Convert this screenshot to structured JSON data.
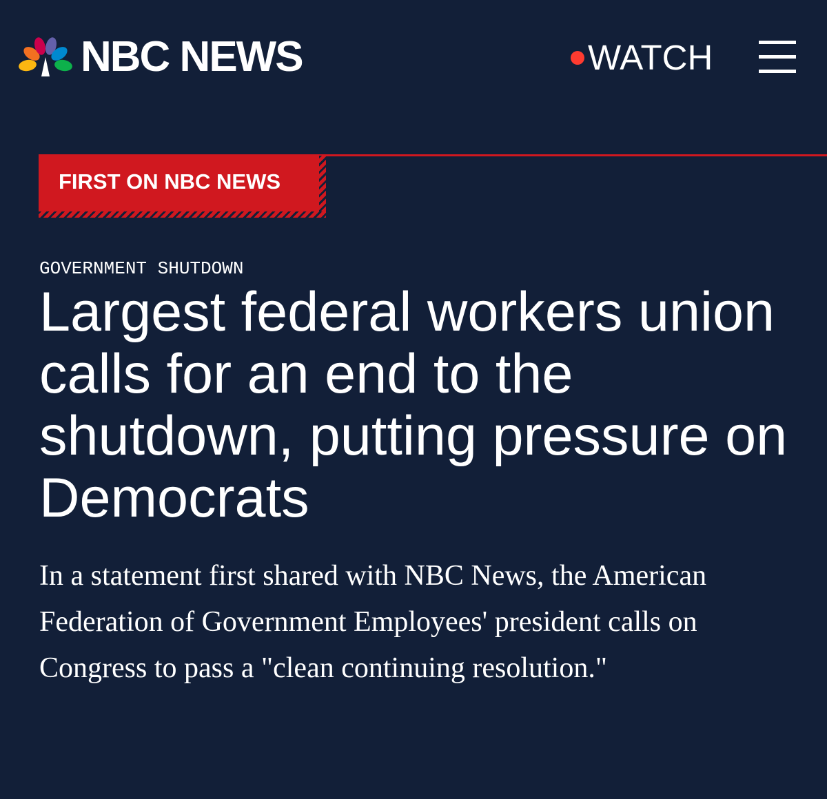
{
  "header": {
    "logo_text": "NBC NEWS",
    "logo_icon": "nbc-peacock-icon",
    "watch_label": "WATCH",
    "live_dot_color": "#ff3b30",
    "menu_icon": "hamburger-menu-icon"
  },
  "article": {
    "label": "FIRST ON NBC NEWS",
    "section": "GOVERNMENT SHUTDOWN",
    "headline": "Largest federal workers union calls for an end to the shutdown, putting pressure on Democrats",
    "dek": "In a statement first shared with NBC News, the American Federation of Government Employees' president calls on Congress to pass a \"clean continuing resolution.\""
  },
  "colors": {
    "background": "#121f38",
    "accent_red": "#d0181f",
    "text": "#ffffff"
  }
}
